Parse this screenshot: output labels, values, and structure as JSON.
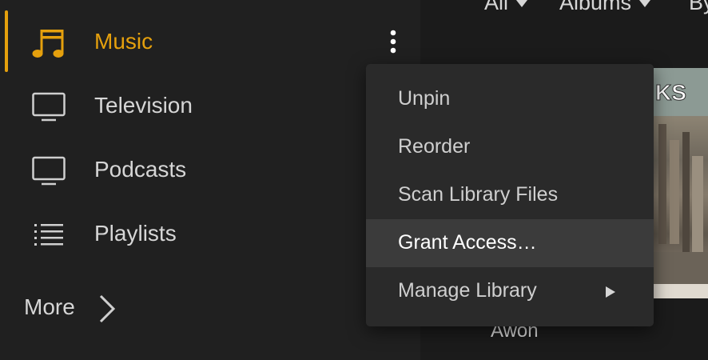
{
  "colors": {
    "accent": "#e5a00d",
    "sidebar_bg": "#202020",
    "menu_bg": "#2a2a2a",
    "menu_hover_bg": "#3b3b3b"
  },
  "sidebar": {
    "items": [
      {
        "label": "Music",
        "icon": "music-note-icon",
        "active": true
      },
      {
        "label": "Television",
        "icon": "monitor-icon"
      },
      {
        "label": "Podcasts",
        "icon": "monitor-icon"
      },
      {
        "label": "Playlists",
        "icon": "list-icon"
      }
    ],
    "more_label": "More",
    "options_icon": "vertical-ellipsis-icon"
  },
  "main": {
    "filters": [
      {
        "label": "All"
      },
      {
        "label": "Albums"
      },
      {
        "label": "By"
      }
    ],
    "album_caption": "Awon"
  },
  "context_menu": {
    "items": [
      {
        "label": "Unpin"
      },
      {
        "label": "Reorder"
      },
      {
        "label": "Scan Library Files"
      },
      {
        "label": "Grant Access…",
        "hovered": true
      },
      {
        "label": "Manage Library",
        "has_submenu": true
      }
    ]
  }
}
